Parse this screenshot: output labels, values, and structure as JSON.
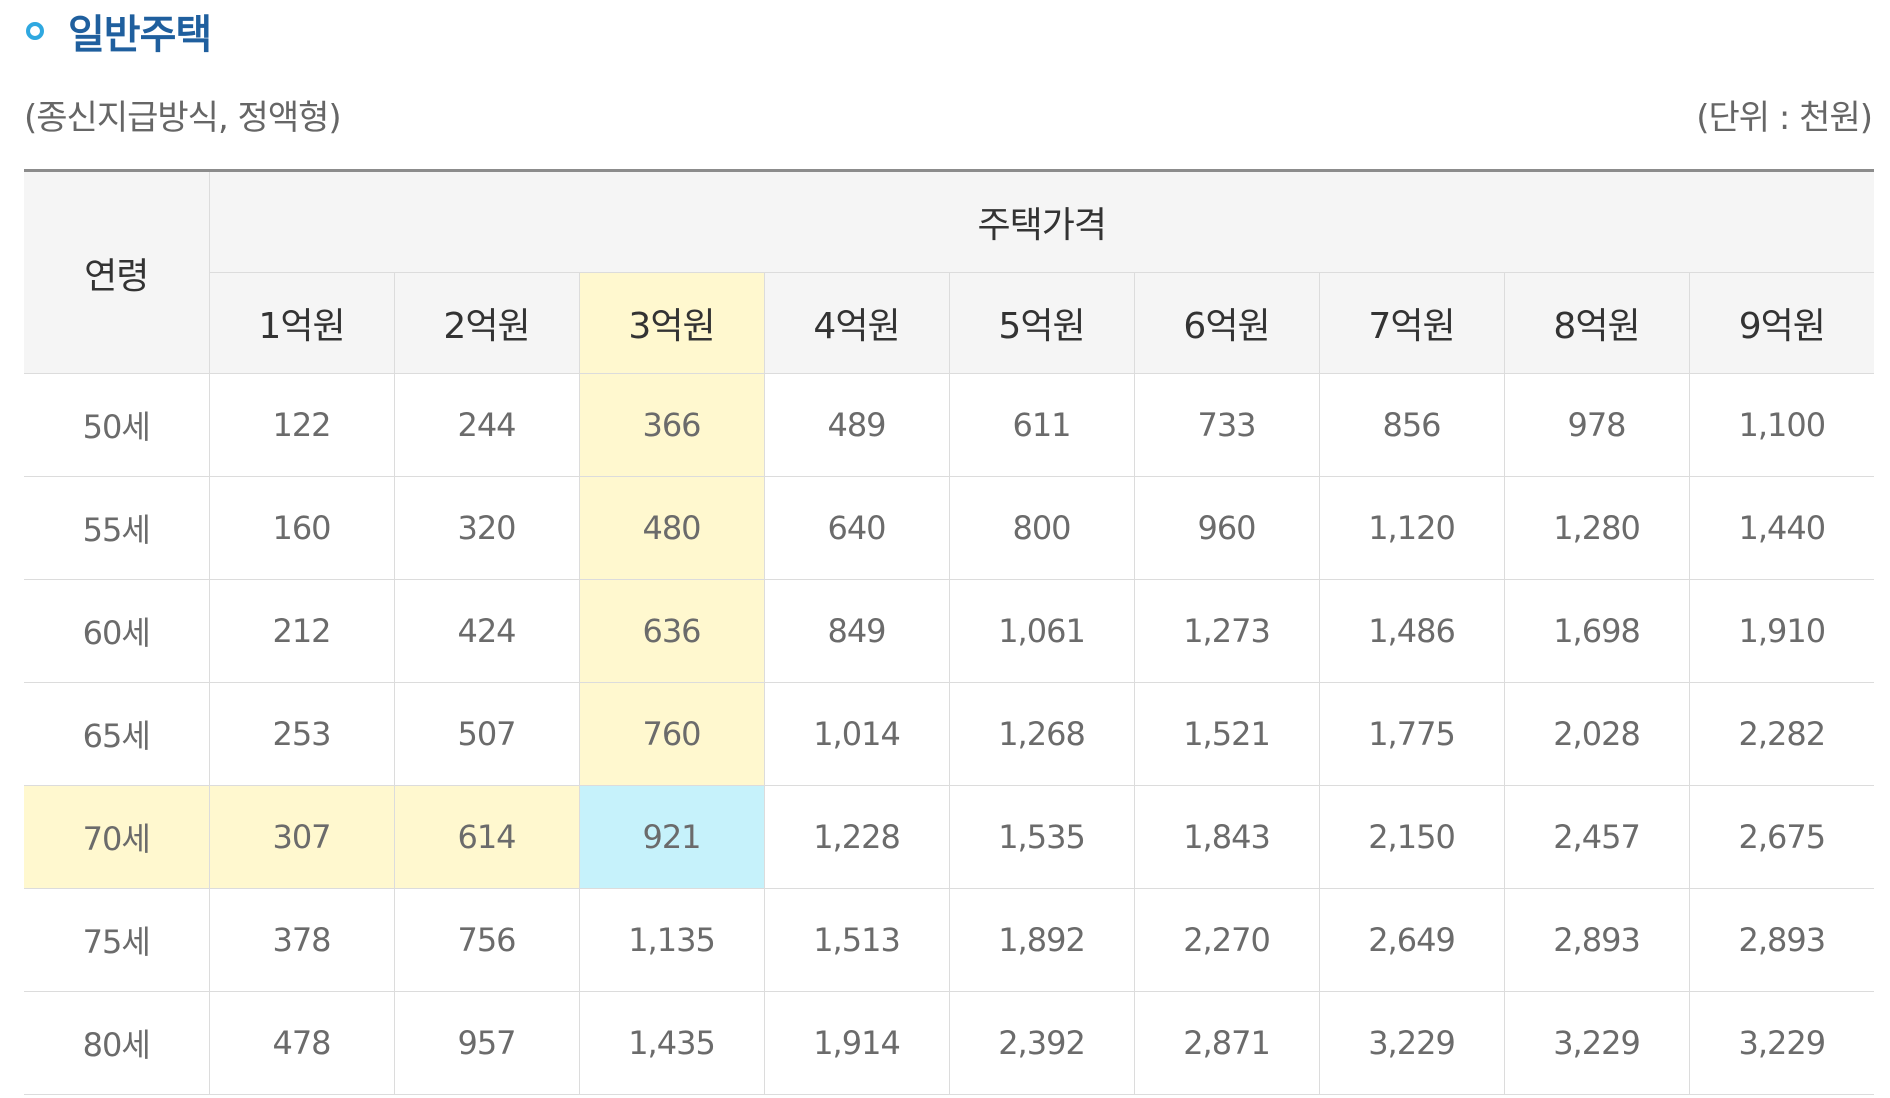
{
  "section": {
    "title": "일반주택",
    "icon": "circle-bullet-icon",
    "accent_color": "#1f5f9e",
    "bullet_color": "#2fa8e0"
  },
  "caption": {
    "left": "(종신지급방식, 정액형)",
    "right": "(단위 : 천원)"
  },
  "table": {
    "age_header": "연령",
    "price_group_header": "주택가격",
    "price_headers": [
      "1억원",
      "2억원",
      "3억원",
      "4억원",
      "5억원",
      "6억원",
      "7억원",
      "8억원",
      "9억원"
    ],
    "highlight_colors": {
      "yellow": "#fff8cf",
      "blue": "#c6f2fb"
    },
    "rows": [
      {
        "age": "50세",
        "values": [
          "122",
          "244",
          "366",
          "489",
          "611",
          "733",
          "856",
          "978",
          "1,100"
        ]
      },
      {
        "age": "55세",
        "values": [
          "160",
          "320",
          "480",
          "640",
          "800",
          "960",
          "1,120",
          "1,280",
          "1,440"
        ]
      },
      {
        "age": "60세",
        "values": [
          "212",
          "424",
          "636",
          "849",
          "1,061",
          "1,273",
          "1,486",
          "1,698",
          "1,910"
        ]
      },
      {
        "age": "65세",
        "values": [
          "253",
          "507",
          "760",
          "1,014",
          "1,268",
          "1,521",
          "1,775",
          "2,028",
          "2,282"
        ]
      },
      {
        "age": "70세",
        "values": [
          "307",
          "614",
          "921",
          "1,228",
          "1,535",
          "1,843",
          "2,150",
          "2,457",
          "2,675"
        ]
      },
      {
        "age": "75세",
        "values": [
          "378",
          "756",
          "1,135",
          "1,513",
          "1,892",
          "2,270",
          "2,649",
          "2,893",
          "2,893"
        ]
      },
      {
        "age": "80세",
        "values": [
          "478",
          "957",
          "1,435",
          "1,914",
          "2,392",
          "2,871",
          "3,229",
          "3,229",
          "3,229"
        ]
      }
    ]
  }
}
